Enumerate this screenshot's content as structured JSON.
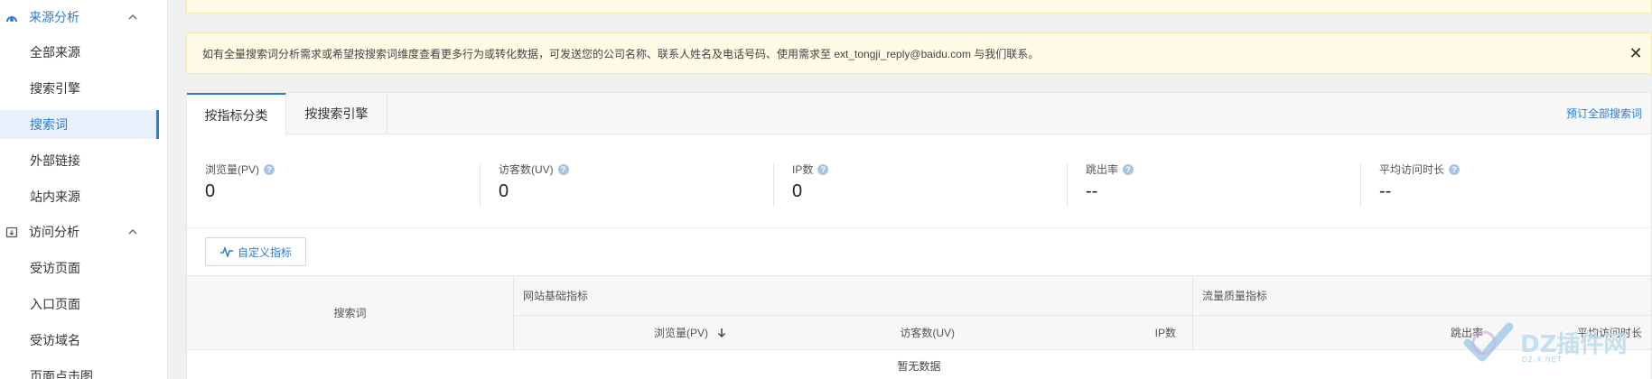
{
  "sidebar": {
    "groups": [
      {
        "label": "来源分析"
      },
      {
        "label": "访问分析"
      }
    ],
    "items": [
      {
        "label": "全部来源"
      },
      {
        "label": "搜索引擎"
      },
      {
        "label": "搜索词"
      },
      {
        "label": "外部链接"
      },
      {
        "label": "站内来源"
      },
      {
        "label": "受访页面"
      },
      {
        "label": "入口页面"
      },
      {
        "label": "受访域名"
      },
      {
        "label": "页面点击图"
      }
    ],
    "active_item": "搜索词"
  },
  "notice": {
    "text": "如有全量搜索词分析需求或希望按搜索词维度查看更多行为或转化数据，可发送您的公司名称、联系人姓名及电话号码、使用需求至 ext_tongji_reply@baidu.com 与我们联系。",
    "close": "✕"
  },
  "tabs": {
    "items": [
      {
        "label": "按指标分类"
      },
      {
        "label": "按搜索引擎"
      }
    ],
    "active": "按指标分类",
    "subscribe_link": "预订全部搜索词"
  },
  "metrics": [
    {
      "label": "浏览量(PV)",
      "value": "0"
    },
    {
      "label": "访客数(UV)",
      "value": "0"
    },
    {
      "label": "IP数",
      "value": "0"
    },
    {
      "label": "跳出率",
      "value": "--"
    },
    {
      "label": "平均访问时长",
      "value": "--"
    }
  ],
  "custom_metric_button": "自定义指标",
  "table": {
    "col_keyword": "搜索词",
    "group_basic": "网站基础指标",
    "group_quality": "流量质量指标",
    "col_pv": "浏览量(PV)",
    "col_uv": "访客数(UV)",
    "col_ip": "IP数",
    "col_bounce": "跳出率",
    "col_avg_time": "平均访问时长",
    "empty_text": "暂无数据"
  },
  "watermark": {
    "text": "DZ插件网",
    "sub": "DZ-X.NET"
  },
  "colors": {
    "accent": "#2b7bd6",
    "notice_bg": "#fffbe6",
    "active_item_bg": "#e8f1fb"
  }
}
